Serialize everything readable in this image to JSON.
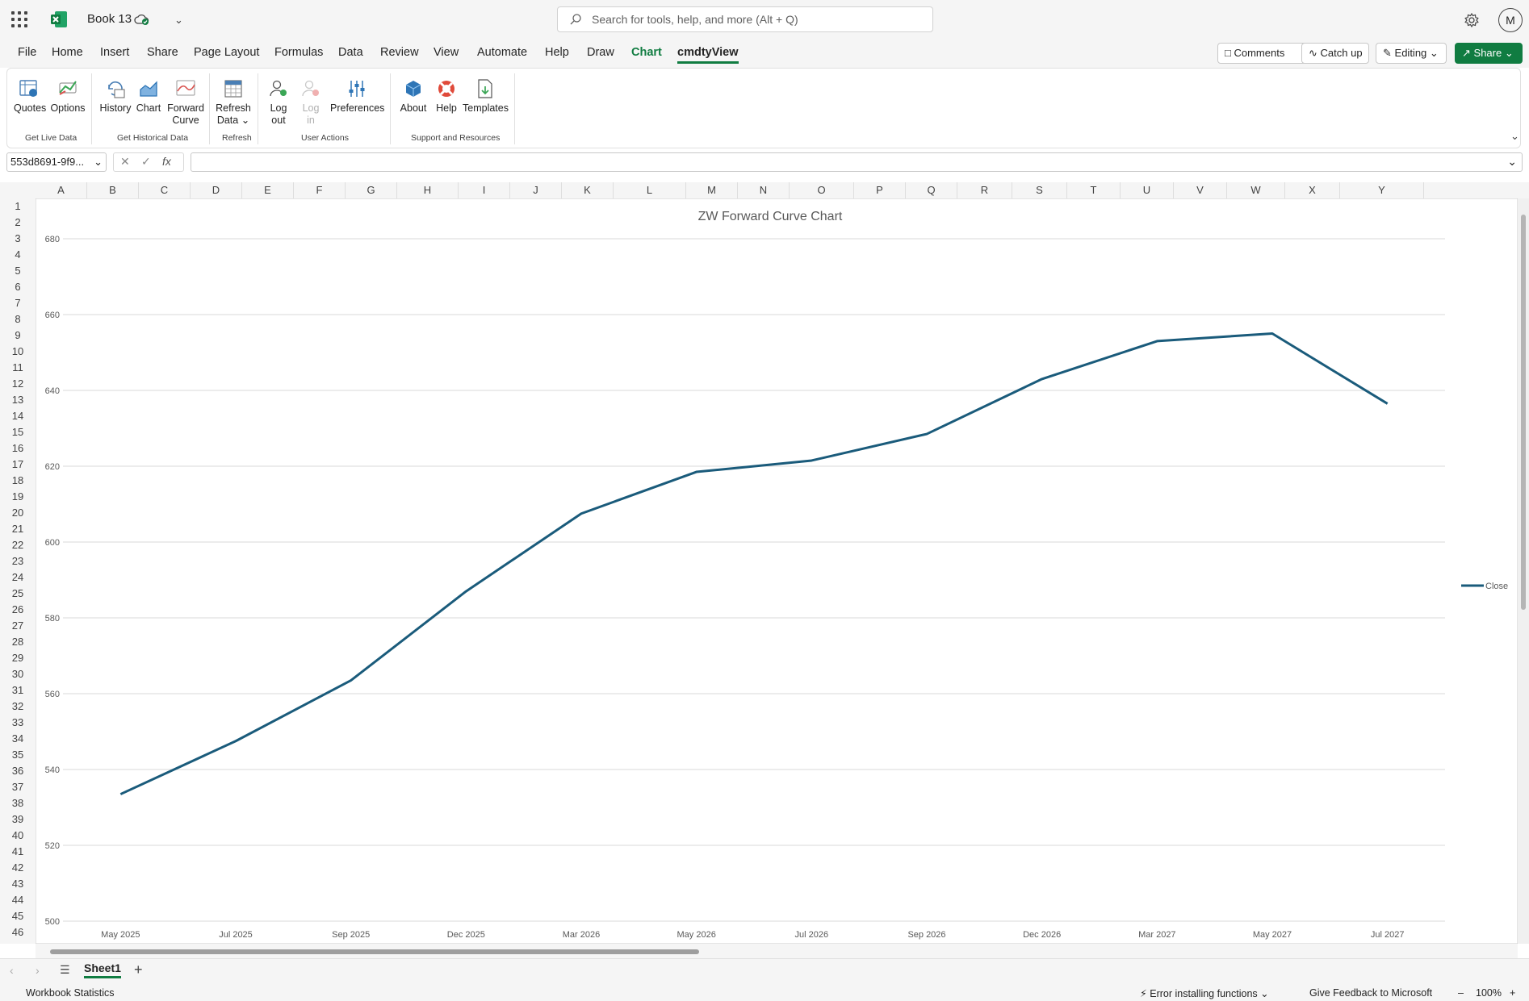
{
  "app": {
    "book_title": "Book 13",
    "search_placeholder": "Search for tools, help, and more (Alt + Q)",
    "avatar_initial": "M",
    "accent_color": "#107c41",
    "series_color": "#1a5b7b"
  },
  "menu": {
    "tabs": [
      "File",
      "Home",
      "Insert",
      "Share",
      "Page Layout",
      "Formulas",
      "Data",
      "Review",
      "View",
      "Automate",
      "Help",
      "Draw",
      "Chart",
      "cmdtyView"
    ],
    "active_tab": "Chart",
    "selected_tab": "cmdtyView",
    "comments_label": "Comments",
    "catchup_label": "Catch up",
    "editing_label": "Editing",
    "share_label": "Share"
  },
  "ribbon": {
    "quotes": "Quotes",
    "options": "Options",
    "group_live": "Get Live Data",
    "history": "History",
    "chart": "Chart",
    "forward_1": "Forward",
    "forward_2": "Curve",
    "group_hist": "Get Historical Data",
    "refresh_1": "Refresh",
    "refresh_2": "Data",
    "group_refresh": "Refresh",
    "logout_1": "Log",
    "logout_2": "out",
    "login_1": "Log",
    "login_2": "in",
    "preferences": "Preferences",
    "group_user": "User Actions",
    "about": "About",
    "help": "Help",
    "templates": "Templates",
    "group_support": "Support and Resources"
  },
  "formula_bar": {
    "name_box": "553d8691-9f9...",
    "fx": "fx",
    "value": ""
  },
  "grid": {
    "columns": [
      "A",
      "B",
      "C",
      "D",
      "E",
      "F",
      "G",
      "H",
      "I",
      "J",
      "K",
      "L",
      "M",
      "N",
      "O",
      "P",
      "Q",
      "R",
      "S",
      "T",
      "U",
      "V",
      "W",
      "X",
      "Y"
    ],
    "rows": [
      "1",
      "2",
      "3",
      "4",
      "5",
      "6",
      "7",
      "8",
      "9",
      "10",
      "11",
      "12",
      "13",
      "14",
      "15",
      "16",
      "17",
      "18",
      "19",
      "20",
      "21",
      "22",
      "23",
      "24",
      "25",
      "26",
      "27",
      "28",
      "29",
      "30",
      "31",
      "32",
      "33",
      "34",
      "35",
      "36",
      "37",
      "38",
      "39",
      "40",
      "41",
      "42",
      "43",
      "44",
      "45",
      "46"
    ]
  },
  "chart_data": {
    "type": "line",
    "title": "ZW Forward Curve Chart",
    "categories": [
      "May 2025",
      "Jul 2025",
      "Sep 2025",
      "Dec 2025",
      "Mar 2026",
      "May 2026",
      "Jul 2026",
      "Sep 2026",
      "Dec 2026",
      "Mar 2027",
      "May 2027",
      "Jul 2027"
    ],
    "series": [
      {
        "name": "Close",
        "values": [
          533.5,
          547.5,
          563.5,
          587,
          607.5,
          618.5,
          621.5,
          628.5,
          643,
          653,
          655,
          636.5
        ]
      }
    ],
    "ylim": [
      500,
      680
    ],
    "yticks": [
      500,
      520,
      540,
      560,
      580,
      600,
      620,
      640,
      660,
      680
    ],
    "grid": true,
    "legend": "right"
  },
  "sheets": {
    "tabs": [
      "Sheet1"
    ]
  },
  "status": {
    "workbook_stats": "Workbook Statistics",
    "error": "Error installing functions",
    "feedback": "Give Feedback to Microsoft",
    "zoom": "100%"
  }
}
